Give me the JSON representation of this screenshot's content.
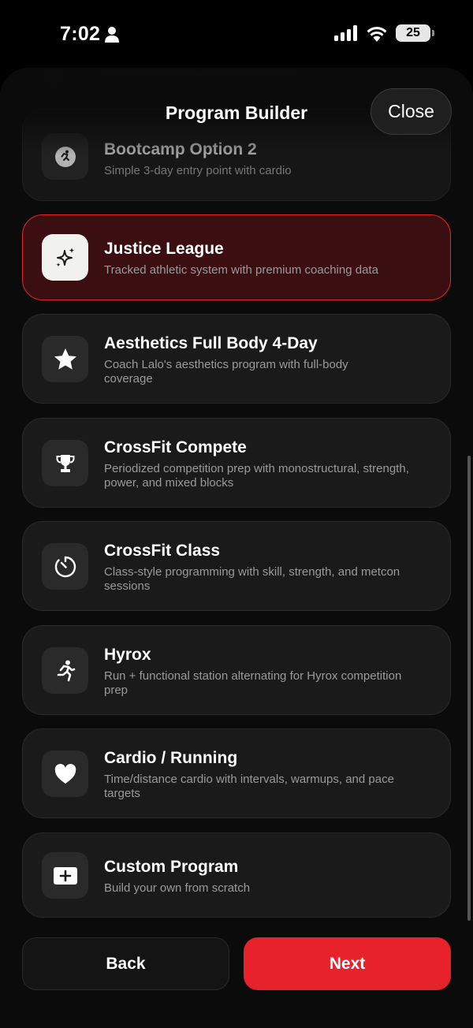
{
  "status_bar": {
    "time": "7:02",
    "battery": "25"
  },
  "header": {
    "title": "Program Builder",
    "close_label": "Close"
  },
  "programs": [
    {
      "title": "Bootcamp Option 2",
      "description": "Simple 3-day entry point with cardio",
      "icon": "running-icon",
      "selected": false
    },
    {
      "title": "Justice League",
      "description": "Tracked athletic system with premium coaching data",
      "icon": "sparkles-icon",
      "selected": true
    },
    {
      "title": "Aesthetics Full Body 4-Day",
      "description": "Coach Lalo's aesthetics program with full-body coverage",
      "icon": "star-icon",
      "selected": false
    },
    {
      "title": "CrossFit Compete",
      "description": "Periodized competition prep with monostructural, strength, power, and mixed blocks",
      "icon": "trophy-icon",
      "selected": false
    },
    {
      "title": "CrossFit Class",
      "description": "Class-style programming with skill, strength, and metcon sessions",
      "icon": "timer-icon",
      "selected": false
    },
    {
      "title": "Hyrox",
      "description": "Run + functional station alternating for Hyrox competition prep",
      "icon": "runner-icon",
      "selected": false
    },
    {
      "title": "Cardio / Running",
      "description": "Time/distance cardio with intervals, warmups, and pace targets",
      "icon": "heart-icon",
      "selected": false
    },
    {
      "title": "Custom Program",
      "description": "Build your own from scratch",
      "icon": "plus-box-icon",
      "selected": false
    }
  ],
  "footer": {
    "back_label": "Back",
    "next_label": "Next"
  },
  "colors": {
    "accent": "#e8222b",
    "selected_bg": "#3b0f12",
    "card_bg": "#1a1a1a"
  }
}
